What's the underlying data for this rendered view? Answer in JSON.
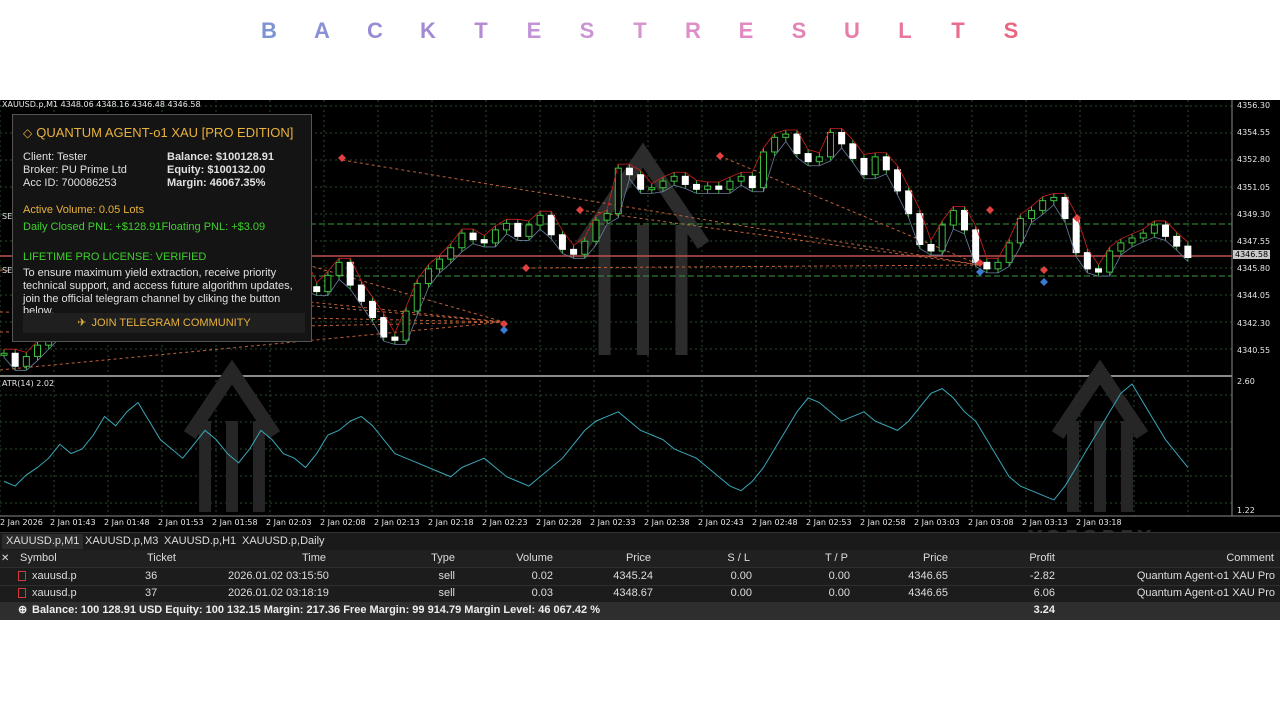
{
  "banner": {
    "letters": [
      "B",
      "A",
      "C",
      "K",
      "T",
      "E",
      "S",
      "T",
      "R",
      "E",
      "S",
      "U",
      "L",
      "T",
      "S"
    ],
    "colors": [
      "#7e93d4",
      "#8a90d6",
      "#978dd6",
      "#a38ad5",
      "#b38cd4",
      "#c293d6",
      "#cc94d4",
      "#d595cf",
      "#dc8fc8",
      "#e08ac0",
      "#e384b6",
      "#e67ea9",
      "#e9769c",
      "#ea6d8e",
      "#ec6580"
    ]
  },
  "chart": {
    "header": "XAUUSD.p,M1  4348.06 4348.16 4346.48 4346.58",
    "price_ticks": [
      "4356.30",
      "4354.55",
      "4352.80",
      "4351.05",
      "4349.30",
      "4347.55",
      "4345.80",
      "4344.05",
      "4342.30",
      "4340.55"
    ],
    "price_range": [
      4339.6,
      4356.6
    ],
    "current_price": "4346.58",
    "atr_label": "ATR(14) 2.02",
    "atr_ticks": [
      "2.60",
      "1.22"
    ],
    "time_ticks": [
      "2 Jan 2026",
      "2 Jan 01:43",
      "2 Jan 01:48",
      "2 Jan 01:53",
      "2 Jan 01:58",
      "2 Jan 02:03",
      "2 Jan 02:08",
      "2 Jan 02:13",
      "2 Jan 02:18",
      "2 Jan 02:23",
      "2 Jan 02:28",
      "2 Jan 02:33",
      "2 Jan 02:38",
      "2 Jan 02:43",
      "2 Jan 02:48",
      "2 Jan 02:53",
      "2 Jan 02:58",
      "2 Jan 03:03",
      "2 Jan 03:08",
      "2 Jan 03:13",
      "2 Jan 03:18"
    ],
    "side_labels": [
      "SE",
      "SE"
    ],
    "watermark": "YOFOREX",
    "closes": [
      4341.0,
      4340.2,
      4340.8,
      4341.5,
      4342.2,
      4343.0,
      4344.2,
      4345.5,
      4347.0,
      4348.6,
      4349.6,
      4350.4,
      4351.2,
      4351.9,
      4352.6,
      4352.3,
      4349.2,
      4348.2,
      4348.4,
      4348.0,
      4348.6,
      4348.9,
      4348.2,
      4347.1,
      4347.9,
      4347.5,
      4346.6,
      4345.1,
      4344.8,
      4345.8,
      4346.6,
      4345.2,
      4344.2,
      4343.2,
      4342.0,
      4341.8,
      4343.6,
      4345.3,
      4346.2,
      4346.8,
      4347.5,
      4348.4,
      4348.0,
      4347.8,
      4348.6,
      4349.0,
      4348.2,
      4348.9,
      4349.5,
      4348.3,
      4347.4,
      4347.1,
      4347.9,
      4349.2,
      4349.6,
      4352.4,
      4352.0,
      4351.1,
      4351.2,
      4351.6,
      4351.9,
      4351.4,
      4351.1,
      4351.3,
      4351.1,
      4351.6,
      4351.9,
      4351.2,
      4353.4,
      4354.3,
      4354.5,
      4353.3,
      4352.8,
      4353.1,
      4354.6,
      4353.9,
      4353.0,
      4352.0,
      4353.1,
      4352.3,
      4351.0,
      4349.6,
      4347.7,
      4347.3,
      4348.9,
      4349.8,
      4348.6,
      4346.6,
      4346.2,
      4346.6,
      4347.8,
      4349.3,
      4349.8,
      4350.4,
      4350.6,
      4349.3,
      4347.2,
      4346.2,
      4346.0,
      4347.3,
      4347.8,
      4348.1,
      4348.4,
      4348.9,
      4348.2,
      4347.6,
      4346.9
    ]
  },
  "panel": {
    "title": "QUANTUM AGENT-o1 XAU [PRO EDITION]",
    "client": "Client: Tester",
    "broker": "Broker: PU Prime Ltd",
    "acc": "Acc ID: 700086253",
    "balance": "Balance: $100128.91",
    "equity": "Equity:  $100132.00",
    "margin": "Margin:  46067.35%",
    "active_volume": "Active Volume: 0.05 Lots",
    "daily_pnl": "Daily Closed PNL: +$128.91",
    "floating_pnl": "Floating PNL: +$3.09",
    "license": "LIFETIME PRO LICENSE: VERIFIED",
    "msg1": "To ensure maximum yield extraction, receive priority",
    "msg2": "technical support, and access future algorithm updates,",
    "msg3": "join the official telegram channel by cliking the button below.",
    "button": "JOIN TELEGRAM COMMUNITY",
    "colors": {
      "gold": "#e9b23c",
      "green": "#3fcf2f"
    }
  },
  "tabs": [
    "XAUUSD.p,M1",
    "XAUUSD.p,M3",
    "XAUUSD.p,H1",
    "XAUUSD.p,Daily"
  ],
  "table": {
    "headers": {
      "symbol": "Symbol",
      "ticket": "Ticket",
      "time": "Time",
      "type": "Type",
      "volume": "Volume",
      "price": "Price",
      "sl": "S / L",
      "tp": "T / P",
      "price2": "Price",
      "profit": "Profit",
      "comment": "Comment"
    },
    "rows": [
      {
        "symbol": "xauusd.p",
        "ticket": "36",
        "time": "2026.01.02 03:15:50",
        "type": "sell",
        "volume": "0.02",
        "price": "4345.24",
        "sl": "0.00",
        "tp": "0.00",
        "price2": "4346.65",
        "profit": "-2.82",
        "comment": "Quantum Agent-o1 XAU Pro"
      },
      {
        "symbol": "xauusd.p",
        "ticket": "37",
        "time": "2026.01.02 03:18:19",
        "type": "sell",
        "volume": "0.03",
        "price": "4348.67",
        "sl": "0.00",
        "tp": "0.00",
        "price2": "4346.65",
        "profit": "6.06",
        "comment": "Quantum Agent-o1 XAU Pro"
      }
    ],
    "summary": "Balance: 100 128.91 USD  Equity: 100 132.15  Margin: 217.36  Free Margin: 99 914.79  Margin Level: 46 067.42 %",
    "summary_profit": "3.24"
  }
}
